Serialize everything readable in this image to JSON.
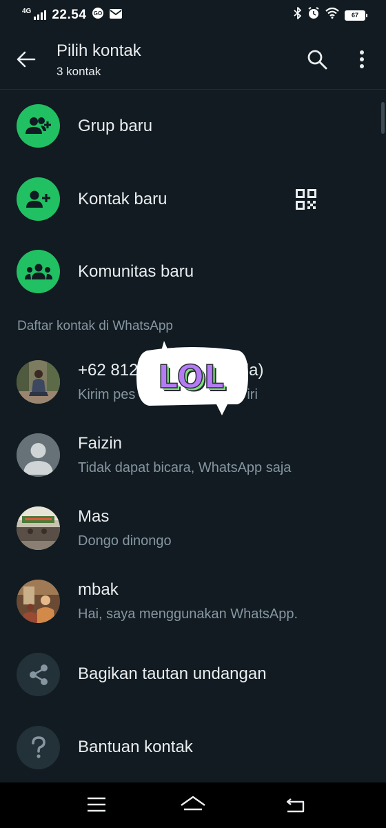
{
  "status_bar": {
    "network": "4G",
    "time": "22.54",
    "battery": "67",
    "icons": [
      "signal-bars-icon",
      "go-app-icon",
      "mail-icon",
      "bluetooth-icon",
      "alarm-icon",
      "wifi-icon",
      "battery-icon"
    ]
  },
  "header": {
    "title": "Pilih kontak",
    "subtitle": "3 kontak",
    "icons": [
      "back-arrow-icon",
      "search-icon",
      "more-vert-icon"
    ]
  },
  "actions": [
    {
      "label": "Grup baru",
      "icon": "group-add-icon"
    },
    {
      "label": "Kontak baru",
      "icon": "person-add-icon",
      "extra_icon": "qr-code-icon"
    },
    {
      "label": "Komunitas baru",
      "icon": "community-icon"
    }
  ],
  "section": {
    "label": "Daftar kontak di WhatsApp"
  },
  "contacts": [
    {
      "name": "+62 812",
      "name_suffix": "Anda)",
      "status": "Kirim pes",
      "status_suffix": "iri"
    },
    {
      "name": "Faizin",
      "status": "Tidak dapat bicara, WhatsApp saja"
    },
    {
      "name": "Mas",
      "status": "Dongo dinongo"
    },
    {
      "name": "mbak",
      "status": "Hai, saya menggunakan WhatsApp."
    }
  ],
  "footer_actions": [
    {
      "label": "Bagikan tautan undangan",
      "icon": "share-icon"
    },
    {
      "label": "Bantuan kontak",
      "icon": "help-icon"
    }
  ],
  "sticker": {
    "text": "LOL"
  },
  "colors": {
    "background": "#111b21",
    "accent": "#21c063",
    "secondary_text": "#8696a0",
    "sticker_purple": "#b57bf4",
    "sticker_green": "#7fe07a"
  }
}
